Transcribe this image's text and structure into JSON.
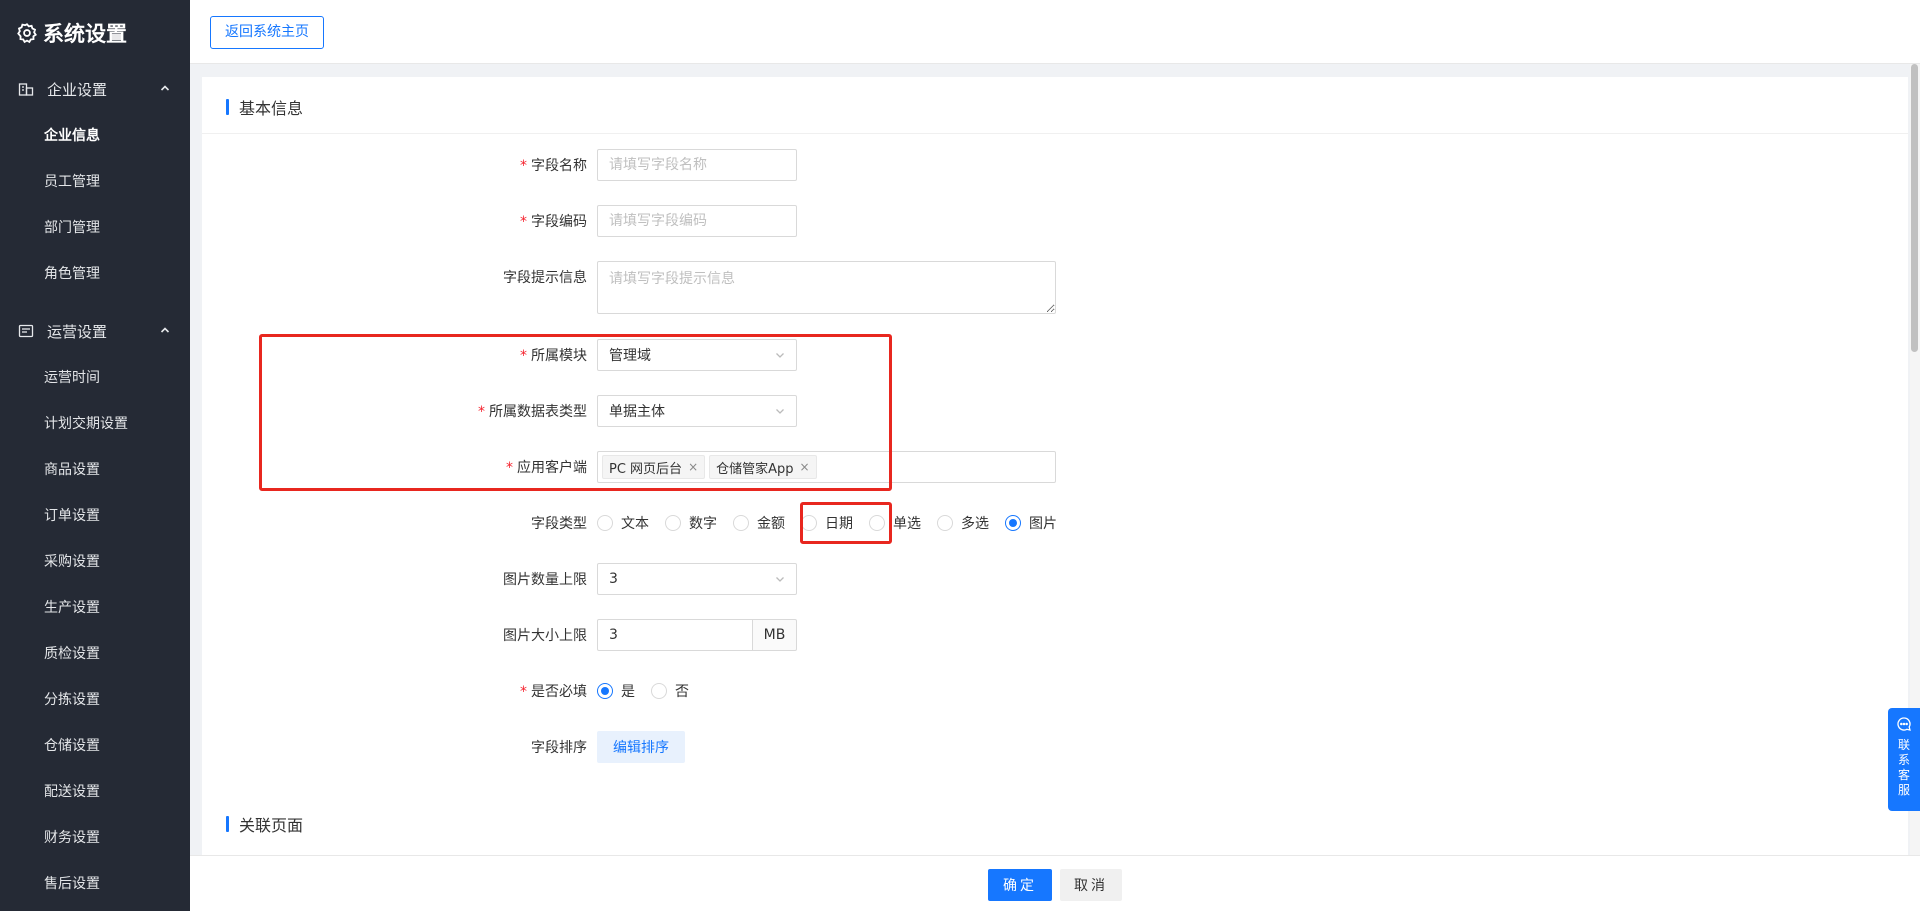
{
  "sidebar": {
    "title": "系统设置",
    "groups": [
      {
        "label": "企业设置",
        "items": [
          "企业信息",
          "员工管理",
          "部门管理",
          "角色管理"
        ]
      },
      {
        "label": "运营设置",
        "items": [
          "运营时间",
          "计划交期设置",
          "商品设置",
          "订单设置",
          "采购设置",
          "生产设置",
          "质检设置",
          "分拣设置",
          "仓储设置",
          "配送设置",
          "财务设置",
          "售后设置"
        ]
      }
    ]
  },
  "topbar": {
    "back_label": "返回系统主页"
  },
  "sections": {
    "basic": "基本信息",
    "related": "关联页面"
  },
  "form": {
    "required_mark": "*",
    "field_name": {
      "label": "字段名称",
      "placeholder": "请填写字段名称"
    },
    "field_code": {
      "label": "字段编码",
      "placeholder": "请填写字段编码"
    },
    "field_hint": {
      "label": "字段提示信息",
      "placeholder": "请填写字段提示信息"
    },
    "module": {
      "label": "所属模块",
      "value": "管理域"
    },
    "table_type": {
      "label": "所属数据表类型",
      "value": "单据主体"
    },
    "clients": {
      "label": "应用客户端",
      "tags": [
        "PC 网页后台",
        "仓储管家App"
      ],
      "remove": "×"
    },
    "field_type": {
      "label": "字段类型",
      "options": [
        "文本",
        "数字",
        "金额",
        "日期",
        "单选",
        "多选",
        "图片"
      ],
      "selected": "图片"
    },
    "image_count": {
      "label": "图片数量上限",
      "value": "3"
    },
    "image_size": {
      "label": "图片大小上限",
      "value": "3",
      "unit": "MB"
    },
    "required": {
      "label": "是否必填",
      "options": [
        "是",
        "否"
      ],
      "selected": "是"
    },
    "sort": {
      "label": "字段排序",
      "button": "编辑排序"
    }
  },
  "footer": {
    "ok": "确定",
    "cancel": "取消"
  },
  "support": {
    "label": "联系客服"
  },
  "colors": {
    "primary": "#1677ff",
    "sidebar_bg": "#252a35",
    "highlight": "#e8271f",
    "required": "#f5222d"
  },
  "icons": {
    "brand": "gear-icon",
    "group1": "building-icon",
    "group2": "list-icon",
    "collapse": "chevron-up-icon",
    "select": "chevron-down-icon",
    "support": "chat-icon"
  }
}
